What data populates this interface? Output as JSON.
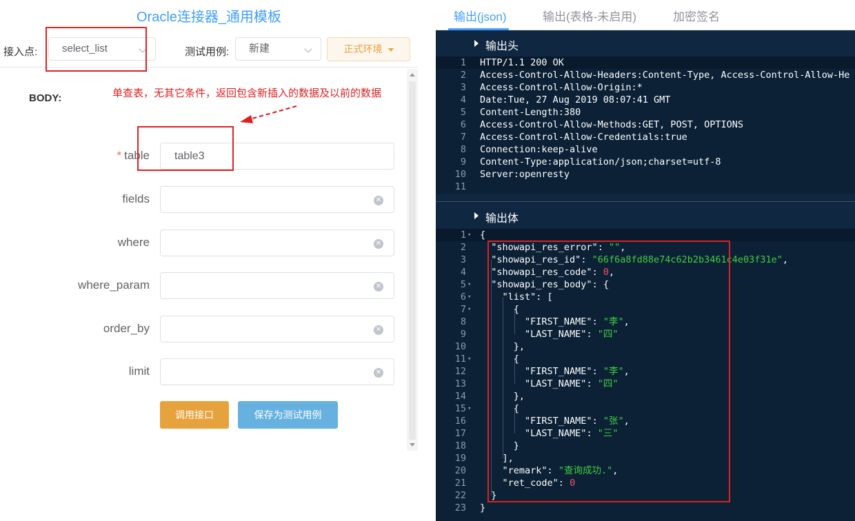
{
  "left": {
    "title": "Oracle连接器_通用模板",
    "endpoint_label": "接入点:",
    "endpoint_value": "select_list",
    "testcase_label": "测试用例:",
    "testcase_value": "新建",
    "env_button": "正式环境",
    "body_heading": "BODY:",
    "annotation": "单查表，无其它条件，返回包含新插入的数据及以前的数据",
    "fields": [
      {
        "label": "table",
        "required": true,
        "value": "table3"
      },
      {
        "label": "fields",
        "required": false,
        "value": ""
      },
      {
        "label": "where",
        "required": false,
        "value": ""
      },
      {
        "label": "where_param",
        "required": false,
        "value": ""
      },
      {
        "label": "order_by",
        "required": false,
        "value": ""
      },
      {
        "label": "limit",
        "required": false,
        "value": ""
      }
    ],
    "required_mark": "*",
    "call_button": "调用接口",
    "save_button": "保存为测试用例",
    "annotation_color": "#e02020"
  },
  "right": {
    "tabs": [
      "输出(json)",
      "输出(表格-未启用)",
      "加密签名"
    ],
    "header_section": "输出头",
    "body_section": "输出体",
    "header_lines": [
      "HTTP/1.1 200 OK",
      "Access-Control-Allow-Headers:Content-Type, Access-Control-Allow-He",
      "Access-Control-Allow-Origin:*",
      "Date:Tue, 27 Aug 2019 08:07:41 GMT",
      "Content-Length:380",
      "Access-Control-Allow-Methods:GET, POST, OPTIONS",
      "Access-Control-Allow-Credentials:true",
      "Connection:keep-alive",
      "Content-Type:application/json;charset=utf-8",
      "Server:openresty",
      ""
    ],
    "body_lines": [
      "{",
      "  \"showapi_res_error\": \"\",",
      "  \"showapi_res_id\": \"66f6a8fd88e74c62b2b3461c4e03f31e\",",
      "  \"showapi_res_code\": 0,",
      "  \"showapi_res_body\": {",
      "    \"list\": [",
      "      {",
      "        \"FIRST_NAME\": \"李\",",
      "        \"LAST_NAME\": \"四\"",
      "      },",
      "      {",
      "        \"FIRST_NAME\": \"李\",",
      "        \"LAST_NAME\": \"四\"",
      "      },",
      "      {",
      "        \"FIRST_NAME\": \"张\",",
      "        \"LAST_NAME\": \"三\"",
      "      }",
      "    ],",
      "    \"remark\": \"查询成功.\",",
      "    \"ret_code\": 0",
      "  }",
      "}"
    ],
    "body_fold_lines": [
      1,
      5,
      6,
      7,
      11,
      15
    ],
    "colors": {
      "background": "#0f2740",
      "string": "#3fd13f",
      "number": "#ff4d6a",
      "accent": "#409eff"
    }
  }
}
